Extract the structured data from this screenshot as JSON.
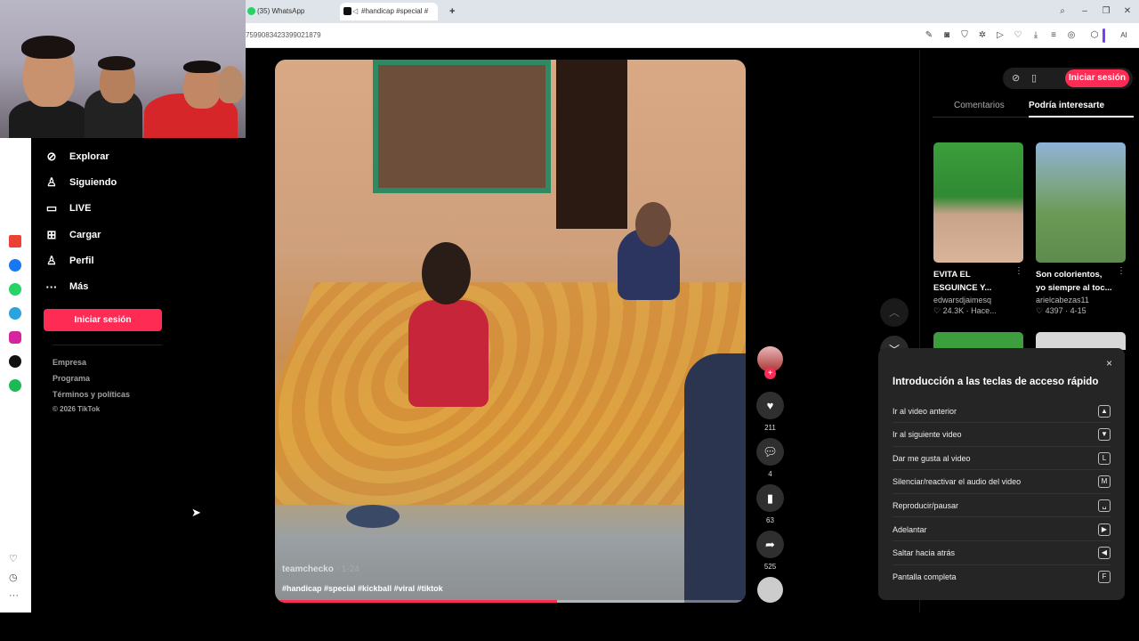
{
  "browser": {
    "tabs": [
      {
        "label": "(35) WhatsApp",
        "icon": "whatsapp-icon"
      },
      {
        "label": "#handicap #special #",
        "icon": "tiktok-icon"
      }
    ],
    "new_tab": "+",
    "url": "7599083423399021879",
    "ai_label": "AI"
  },
  "nav": {
    "items": [
      {
        "label": "Explorar",
        "icon": "compass-icon"
      },
      {
        "label": "Siguiendo",
        "icon": "person-icon"
      },
      {
        "label": "LIVE",
        "icon": "live-icon"
      },
      {
        "label": "Cargar",
        "icon": "upload-icon"
      },
      {
        "label": "Perfil",
        "icon": "profile-icon"
      },
      {
        "label": "Más",
        "icon": "more-dots-icon"
      }
    ],
    "login": "Iniciar sesión",
    "footer": [
      "Empresa",
      "Programa",
      "Términos y políticas",
      "© 2026 TikTok"
    ]
  },
  "video": {
    "author": "teamchecko",
    "date": "· 1-24",
    "hashtags": "#handicap #special #kickball #viral #tiktok",
    "progress": 0.6
  },
  "actions": {
    "likes": "211",
    "comments": "4",
    "saves": "63",
    "shares": "525"
  },
  "panel": {
    "login": "Iniciar sesión",
    "tabs": [
      "Comentarios",
      "Podría interesarte"
    ],
    "cards": [
      {
        "title": "EVITA EL ESGUINCE Y...",
        "user": "edwarsdjaimesq",
        "stats": "♡ 24.3K · Hace..."
      },
      {
        "title": "Son colorientos, yo siempre al toc...",
        "user": "arielcabezas11",
        "stats": "♡ 4397 · 4-15"
      }
    ]
  },
  "shortcuts": {
    "title": "Introducción a las teclas de acceso rápido",
    "close": "×",
    "rows": [
      {
        "label": "Ir al video anterior",
        "key": "▲"
      },
      {
        "label": "Ir al siguiente video",
        "key": "▼"
      },
      {
        "label": "Dar me gusta al video",
        "key": "L"
      },
      {
        "label": "Silenciar/reactivar el audio del video",
        "key": "M"
      },
      {
        "label": "Reproducir/pausar",
        "key": "␣"
      },
      {
        "label": "Adelantar",
        "key": "▶"
      },
      {
        "label": "Saltar hacia atrás",
        "key": "◀"
      },
      {
        "label": "Pantalla completa",
        "key": "F"
      }
    ]
  }
}
